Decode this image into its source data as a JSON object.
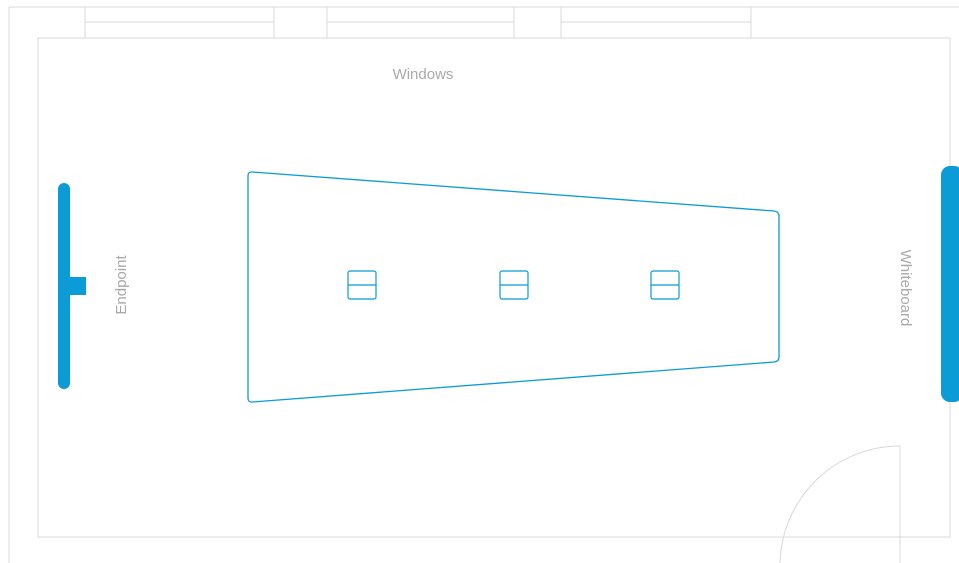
{
  "room": {
    "windows_label": "Windows",
    "endpoint_label": "Endpoint",
    "whiteboard_label": "Whiteboard",
    "seat_count": 3
  },
  "colors": {
    "accent": "#0b9bd7",
    "wall_line": "#d8d8d8",
    "label_text": "#a9a9a9",
    "background": "#ffffff"
  }
}
